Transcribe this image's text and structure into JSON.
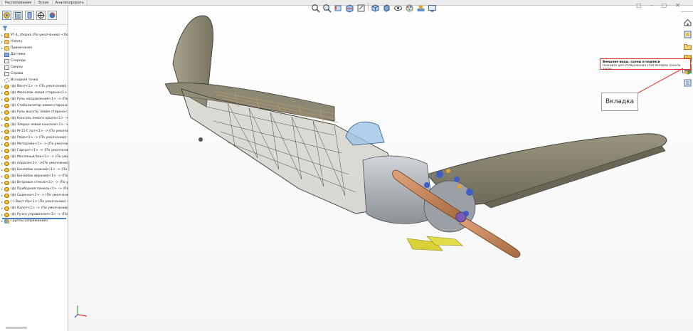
{
  "menu_tabs": [
    "Распиливание",
    "Эскиз",
    "Анализировать"
  ],
  "manager_tabs": [
    {
      "icon": "feature-manager-icon",
      "active": true
    },
    {
      "icon": "property-manager-icon",
      "active": false
    },
    {
      "icon": "configuration-manager-icon",
      "active": false
    },
    {
      "icon": "dimxpert-manager-icon",
      "active": false
    },
    {
      "icon": "display-manager-icon",
      "active": false
    }
  ],
  "tree": {
    "root": "УТ-1_сборка (По умолчанию) <По умо",
    "items": [
      {
        "label": "History",
        "icon": "folder"
      },
      {
        "label": "Примечания",
        "icon": "folder"
      },
      {
        "label": "Датчики",
        "icon": "sensor"
      },
      {
        "label": "Спереди",
        "icon": "plane"
      },
      {
        "label": "Сверху",
        "icon": "plane"
      },
      {
        "label": "Справа",
        "icon": "plane"
      },
      {
        "label": "Исходная точка",
        "icon": "origin"
      },
      {
        "label": "(ф) Винт<1> -> (По умолчанию) <",
        "icon": "part"
      },
      {
        "label": "(ф) Фюзеляж левая сторона<1> -> (",
        "icon": "part"
      },
      {
        "label": "(ф) Руль направления<1> -> (По у",
        "icon": "part"
      },
      {
        "label": "(ф) Стабилизатор левая сторона<1",
        "icon": "part"
      },
      {
        "label": "(ф) Руль высоты левая сторона<1>",
        "icon": "part"
      },
      {
        "label": "(ф) Консоль левого крыла<1> -> (",
        "icon": "part"
      },
      {
        "label": "(ф) Элерон левой консоли<1> -> (",
        "icon": "part"
      },
      {
        "label": "(ф) М-11-Г.прт<1> -> (По умолчание",
        "icon": "part"
      },
      {
        "label": "(ф) Рама<1> -> (По умолчанию) <",
        "icon": "part"
      },
      {
        "label": "(ф) Моторама<1> -> (По умолчани",
        "icon": "part"
      },
      {
        "label": "(ф) Гаргрот<1> -> (По умолчанию) <",
        "icon": "part"
      },
      {
        "label": "(ф) Масляный бак<1> -> (По умол",
        "icon": "part"
      },
      {
        "label": "(ф) педали<1> ->(По умолчанию)",
        "icon": "part"
      },
      {
        "label": "(ф) Бензобак нижний<1> -> (По у",
        "icon": "part"
      },
      {
        "label": "(ф) Бензобак верхний<1> -> (По у",
        "icon": "part"
      },
      {
        "label": "(ф) Ветровое стекло<1> -> (По ум",
        "icon": "part"
      },
      {
        "label": "(ф) Приборная панель<1> -> (По у",
        "icon": "part"
      },
      {
        "label": "(ф) Сиденье<1> -> (По умолчани",
        "icon": "part"
      },
      {
        "label": "(-) Винт.sfp<1> (По умолчанию) <",
        "icon": "part"
      },
      {
        "label": "(ф) Капот<1> -> (По умолчанию) <",
        "icon": "part"
      },
      {
        "label": "(ф) Ручка управления<1> -> (По у",
        "icon": "part"
      },
      {
        "label": "Группы сопряжений1",
        "icon": "mates"
      }
    ]
  },
  "heads_up_toolbar": [
    "zoom-to-fit-icon",
    "zoom-to-area-icon",
    "previous-view-icon",
    "section-view-icon",
    "dynamic-annotation-icon",
    "view-orientation-icon",
    "display-style-icon",
    "hide-show-items-icon",
    "edit-appearance-icon",
    "apply-scene-icon",
    "view-settings-icon"
  ],
  "task_pane": [
    {
      "icon": "home-icon",
      "active": false
    },
    {
      "icon": "design-library-icon",
      "active": false
    },
    {
      "icon": "file-explorer-icon",
      "active": false
    },
    {
      "icon": "view-palette-icon",
      "active": false
    },
    {
      "icon": "appearances-scenes-icon",
      "active": true
    },
    {
      "icon": "custom-properties-icon",
      "active": false
    }
  ],
  "tooltip": {
    "title": "Внешние виды, сцены и надписи",
    "body": "Нажмите для отображения этой вкладки панели задач."
  },
  "callout_label": "Вкладка",
  "colors": {
    "tooltip_border": "#e2342b",
    "selection_accent": "#4a7fc1",
    "airframe": "#8f8a78",
    "propeller": "#c98a63"
  }
}
